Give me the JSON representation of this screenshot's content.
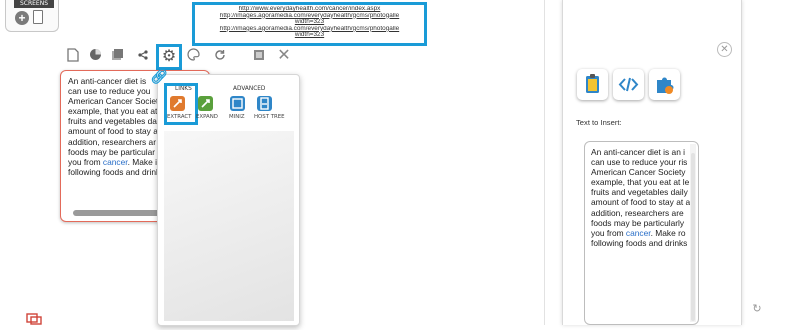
{
  "screens": {
    "label": "SCREENS"
  },
  "urls": [
    "http://www.everydayhealth.com/cancer/index.aspx",
    "http://images.agoramedia.com/everydayhealth/gcms/photogalle",
    "width=323",
    "http://images.agoramedia.com/everydayhealth/gcms/photogalle",
    "width=323"
  ],
  "article": {
    "lines_left": [
      "An anti-cancer diet is",
      "can use to reduce you",
      "American Cancer Societ",
      "example, that you eat at",
      "fruits and vegetables da",
      "amount of food to stay a",
      "addition, researchers ar",
      "foods may be particular",
      "you from ",
      "following foods and drinks"
    ],
    "lines_right": [
      "An anti-cancer diet is an i",
      "can use to reduce your ris",
      "American Cancer Society",
      "example, that you eat at le",
      "fruits and vegetables daily",
      "amount of food to stay at a",
      "addition, researchers are",
      "foods may be particularly",
      "you from ",
      "following foods and drinks"
    ],
    "link_word": "cancer",
    "after_link_left": ". Make i",
    "after_link_right": ". Make ro"
  },
  "panel": {
    "section_links": "LINKS",
    "section_advanced": "ADVANCED",
    "tools": [
      {
        "label": "EXTRACT",
        "color": "#e07a2e"
      },
      {
        "label": "EXPAND",
        "color": "#5aa03c"
      },
      {
        "label": "MINIZ",
        "color": "#2f86c8"
      },
      {
        "label": "HOST TREE",
        "color": "#2f86c8"
      }
    ]
  },
  "right_panel": {
    "text_to_insert_label": "Text to Insert:"
  },
  "colors": {
    "highlight": "#1a9bd7",
    "card_border": "#e36a5a",
    "link": "#2a6fc8"
  }
}
